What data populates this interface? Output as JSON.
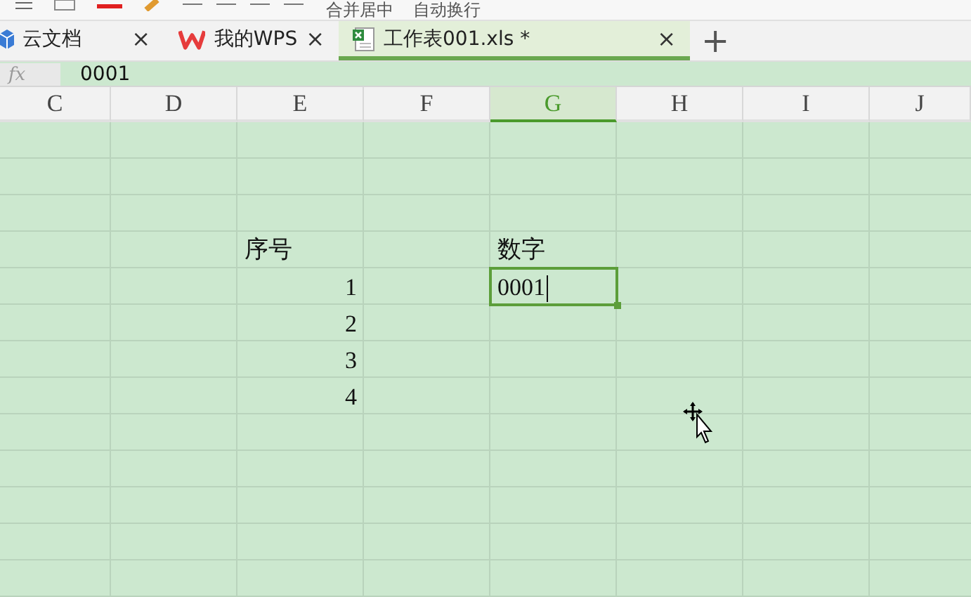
{
  "toolbar": {
    "labels": [
      "合并居中",
      "自动换行"
    ]
  },
  "tabs": [
    {
      "label": "云文档",
      "kind": "cloud",
      "selected": false,
      "close": "×"
    },
    {
      "label": "我的WPS",
      "kind": "wps",
      "selected": false,
      "close": "×"
    },
    {
      "label": "工作表001.xls *",
      "kind": "sheet",
      "selected": true,
      "close": "×"
    }
  ],
  "new_tab": "+",
  "formula_bar": {
    "label": "fx",
    "value": "0001"
  },
  "columns": [
    {
      "label": "C",
      "selected": false
    },
    {
      "label": "D",
      "selected": false
    },
    {
      "label": "E",
      "selected": false
    },
    {
      "label": "F",
      "selected": false
    },
    {
      "label": "G",
      "selected": true
    },
    {
      "label": "H",
      "selected": false
    },
    {
      "label": "I",
      "selected": false
    },
    {
      "label": "J",
      "selected": false
    }
  ],
  "rows": [
    {
      "cells": [
        null,
        null,
        {
          "text": "序号",
          "kind": "text",
          "selected": false
        },
        null,
        {
          "text": "数字",
          "kind": "text",
          "selected": false
        },
        null,
        null,
        null
      ]
    },
    {
      "cells": [
        null,
        null,
        {
          "text": "1",
          "kind": "number",
          "selected": false
        },
        null,
        {
          "text": "0001",
          "kind": "text",
          "selected": true
        },
        null,
        null,
        null
      ]
    },
    {
      "cells": [
        null,
        null,
        {
          "text": "2",
          "kind": "number",
          "selected": false
        },
        null,
        null,
        null,
        null,
        null
      ]
    },
    {
      "cells": [
        null,
        null,
        {
          "text": "3",
          "kind": "number",
          "selected": false
        },
        null,
        null,
        null,
        null,
        null
      ]
    },
    {
      "cells": [
        null,
        null,
        {
          "text": "4",
          "kind": "number",
          "selected": false
        },
        null,
        null,
        null,
        null,
        null
      ]
    }
  ]
}
